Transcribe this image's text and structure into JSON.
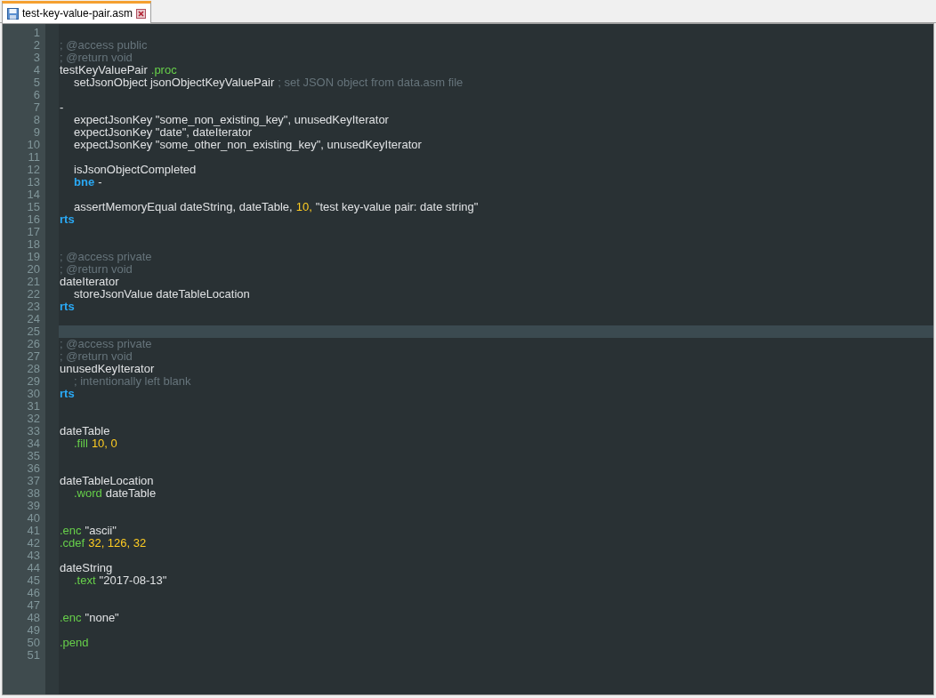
{
  "tabs": [
    {
      "label": "test-key-value-pair.asm",
      "selected": true
    }
  ],
  "lines": [
    {
      "n": "1",
      "current": false
    },
    {
      "n": "2",
      "current": false,
      "indent": false,
      "tokens": [
        {
          "kind": "comment",
          "text": "; @access public"
        }
      ]
    },
    {
      "n": "3",
      "current": false,
      "indent": false,
      "tokens": [
        {
          "kind": "comment",
          "text": "; @return void"
        }
      ]
    },
    {
      "n": "4",
      "current": false,
      "indent": false,
      "tokens": [
        {
          "kind": "text",
          "text": "testKeyValuePair"
        },
        {
          "kind": "directive",
          "text": ".proc"
        }
      ]
    },
    {
      "n": "5",
      "current": false,
      "indent": true,
      "tokens": [
        {
          "kind": "text",
          "text": "setJsonObject jsonObjectKeyValuePair"
        },
        {
          "kind": "comment",
          "text": "; set JSON object from data.asm file"
        }
      ]
    },
    {
      "n": "6",
      "current": false
    },
    {
      "n": "7",
      "current": false,
      "indent": false,
      "tokens": [
        {
          "kind": "text",
          "text": "-"
        }
      ]
    },
    {
      "n": "8",
      "current": false,
      "indent": true,
      "tokens": [
        {
          "kind": "text",
          "text": "expectJsonKey \"some_non_existing_key\", unusedKeyIterator"
        }
      ]
    },
    {
      "n": "9",
      "current": false,
      "indent": true,
      "tokens": [
        {
          "kind": "text",
          "text": "expectJsonKey \"date\", dateIterator"
        }
      ]
    },
    {
      "n": "10",
      "current": false,
      "indent": true,
      "tokens": [
        {
          "kind": "text",
          "text": "expectJsonKey \"some_other_non_existing_key\", unusedKeyIterator"
        }
      ]
    },
    {
      "n": "11",
      "current": false
    },
    {
      "n": "12",
      "current": false,
      "indent": true,
      "tokens": [
        {
          "kind": "text",
          "text": "isJsonObjectCompleted"
        }
      ]
    },
    {
      "n": "13",
      "current": false,
      "indent": true,
      "tokens": [
        {
          "kind": "keyword",
          "text": "bne"
        },
        {
          "kind": "text",
          "text": "-"
        }
      ]
    },
    {
      "n": "14",
      "current": false
    },
    {
      "n": "15",
      "current": false,
      "indent": true,
      "tokens": [
        {
          "kind": "text",
          "text": "assertMemoryEqual dateString, dateTable,"
        },
        {
          "kind": "number",
          "text": "10,"
        },
        {
          "kind": "text",
          "text": "\"test key-value pair: date string\""
        }
      ]
    },
    {
      "n": "16",
      "current": false,
      "indent": false,
      "tokens": [
        {
          "kind": "keyword",
          "text": "rts"
        }
      ]
    },
    {
      "n": "17",
      "current": false
    },
    {
      "n": "18",
      "current": false
    },
    {
      "n": "19",
      "current": false,
      "indent": false,
      "tokens": [
        {
          "kind": "comment",
          "text": "; @access private"
        }
      ]
    },
    {
      "n": "20",
      "current": false,
      "indent": false,
      "tokens": [
        {
          "kind": "comment",
          "text": "; @return void"
        }
      ]
    },
    {
      "n": "21",
      "current": false,
      "indent": false,
      "tokens": [
        {
          "kind": "text",
          "text": "dateIterator"
        }
      ]
    },
    {
      "n": "22",
      "current": false,
      "indent": true,
      "tokens": [
        {
          "kind": "text",
          "text": "storeJsonValue dateTableLocation"
        }
      ]
    },
    {
      "n": "23",
      "current": false,
      "indent": false,
      "tokens": [
        {
          "kind": "keyword",
          "text": "rts"
        }
      ]
    },
    {
      "n": "24",
      "current": false
    },
    {
      "n": "25",
      "current": true
    },
    {
      "n": "26",
      "current": false,
      "indent": false,
      "tokens": [
        {
          "kind": "comment",
          "text": "; @access private"
        }
      ]
    },
    {
      "n": "27",
      "current": false,
      "indent": false,
      "tokens": [
        {
          "kind": "comment",
          "text": "; @return void"
        }
      ]
    },
    {
      "n": "28",
      "current": false,
      "indent": false,
      "tokens": [
        {
          "kind": "text",
          "text": "unusedKeyIterator"
        }
      ]
    },
    {
      "n": "29",
      "current": false,
      "indent": true,
      "tokens": [
        {
          "kind": "comment",
          "text": "; intentionally left blank"
        }
      ]
    },
    {
      "n": "30",
      "current": false,
      "indent": false,
      "tokens": [
        {
          "kind": "keyword",
          "text": "rts"
        }
      ]
    },
    {
      "n": "31",
      "current": false
    },
    {
      "n": "32",
      "current": false
    },
    {
      "n": "33",
      "current": false,
      "indent": false,
      "tokens": [
        {
          "kind": "text",
          "text": "dateTable"
        }
      ]
    },
    {
      "n": "34",
      "current": false,
      "indent": true,
      "tokens": [
        {
          "kind": "directive",
          "text": ".fill"
        },
        {
          "kind": "number",
          "text": "10, 0"
        }
      ]
    },
    {
      "n": "35",
      "current": false
    },
    {
      "n": "36",
      "current": false
    },
    {
      "n": "37",
      "current": false,
      "indent": false,
      "tokens": [
        {
          "kind": "text",
          "text": "dateTableLocation"
        }
      ]
    },
    {
      "n": "38",
      "current": false,
      "indent": true,
      "tokens": [
        {
          "kind": "directive",
          "text": ".word"
        },
        {
          "kind": "text",
          "text": "dateTable"
        }
      ]
    },
    {
      "n": "39",
      "current": false
    },
    {
      "n": "40",
      "current": false
    },
    {
      "n": "41",
      "current": false,
      "indent": false,
      "tokens": [
        {
          "kind": "directive",
          "text": ".enc"
        },
        {
          "kind": "text",
          "text": "\"ascii\""
        }
      ]
    },
    {
      "n": "42",
      "current": false,
      "indent": false,
      "tokens": [
        {
          "kind": "directive",
          "text": ".cdef"
        },
        {
          "kind": "number",
          "text": "32, 126, 32"
        }
      ]
    },
    {
      "n": "43",
      "current": false
    },
    {
      "n": "44",
      "current": false,
      "indent": false,
      "tokens": [
        {
          "kind": "text",
          "text": "dateString"
        }
      ]
    },
    {
      "n": "45",
      "current": false,
      "indent": true,
      "tokens": [
        {
          "kind": "directive",
          "text": ".text"
        },
        {
          "kind": "text",
          "text": "\"2017-08-13\""
        }
      ]
    },
    {
      "n": "46",
      "current": false
    },
    {
      "n": "47",
      "current": false
    },
    {
      "n": "48",
      "current": false,
      "indent": false,
      "tokens": [
        {
          "kind": "directive",
          "text": ".enc"
        },
        {
          "kind": "text",
          "text": "\"none\""
        }
      ]
    },
    {
      "n": "49",
      "current": false
    },
    {
      "n": "50",
      "current": false,
      "indent": false,
      "tokens": [
        {
          "kind": "directive",
          "text": ".pend"
        }
      ]
    },
    {
      "n": "51",
      "current": false
    }
  ]
}
